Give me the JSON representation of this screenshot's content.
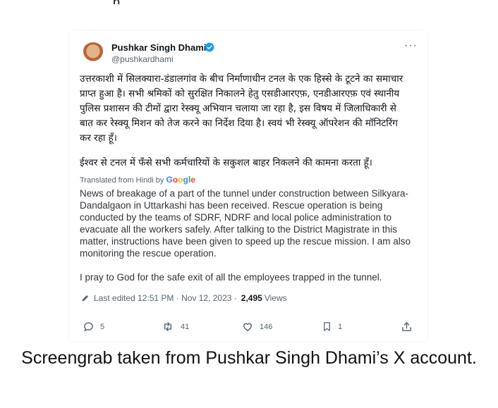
{
  "top_crop_text": "p",
  "tweet": {
    "author_name": "Pushkar Singh Dhami",
    "handle": "@pushkardhami",
    "more_label": "···",
    "hindi_paragraphs": [
      "उत्तरकाशी में सिलक्यारा-डंडालगांव के बीच निर्माणाधीन टनल के एक हिस्से के टूटने का समाचार प्राप्त हुआ है। सभी श्रमिकों को सुरक्षित निकालने हेतु एसडीआरएफ़, एनडीआरएफ़ एवं स्थानीय पुलिस प्रशासन की टीमों द्वारा रेस्क्यू अभियान चलाया जा रहा है, इस विषय में जिलाधिकारी से बात कर रेस्क्यू मिशन को तेज करने का निर्देश दिया है। स्वयं भी रेस्क्यू ऑपरेशन की मॉनिटरिंग कर रहा हूँ।",
      "ईश्वर से टनल में फँसे सभी कर्मचारियों के सकुशल बाहर निकलने की कामना करता हूँ।"
    ],
    "translated_label": "Translated from Hindi by",
    "google_label": "Google",
    "english_paragraphs": [
      "News of breakage of a part of the tunnel under construction between Silkyara-Dandalgaon in Uttarkashi has been received. Rescue operation is being conducted by the teams of SDRF, NDRF and local police administration to evacuate all the workers safely. After talking to the District Magistrate in this matter, instructions have been given to speed up the rescue mission. I am also monitoring the rescue operation.",
      "I pray to God for the safe exit of all the employees trapped in the tunnel."
    ],
    "meta": {
      "edited_text": "Last edited 12:51 PM · Nov 12, 2023 ·",
      "views_count": "2,495",
      "views_label": "Views"
    },
    "actions": {
      "replies": "5",
      "reposts": "41",
      "likes": "146",
      "bookmarks": "1"
    }
  },
  "caption": "Screengrab taken from Pushkar Singh Dhami’s X account.",
  "colors": {
    "text_primary": "#0f1419",
    "text_secondary": "#536471",
    "verified_blue": "#1d9bf0",
    "google_blue": "#4285f4",
    "google_red": "#ea4335",
    "google_yellow": "#fbbc05",
    "google_green": "#34a853"
  },
  "icons": [
    "verified-badge-icon",
    "more-icon",
    "pencil-icon",
    "reply-icon",
    "repost-icon",
    "like-icon",
    "bookmark-icon",
    "share-icon"
  ]
}
